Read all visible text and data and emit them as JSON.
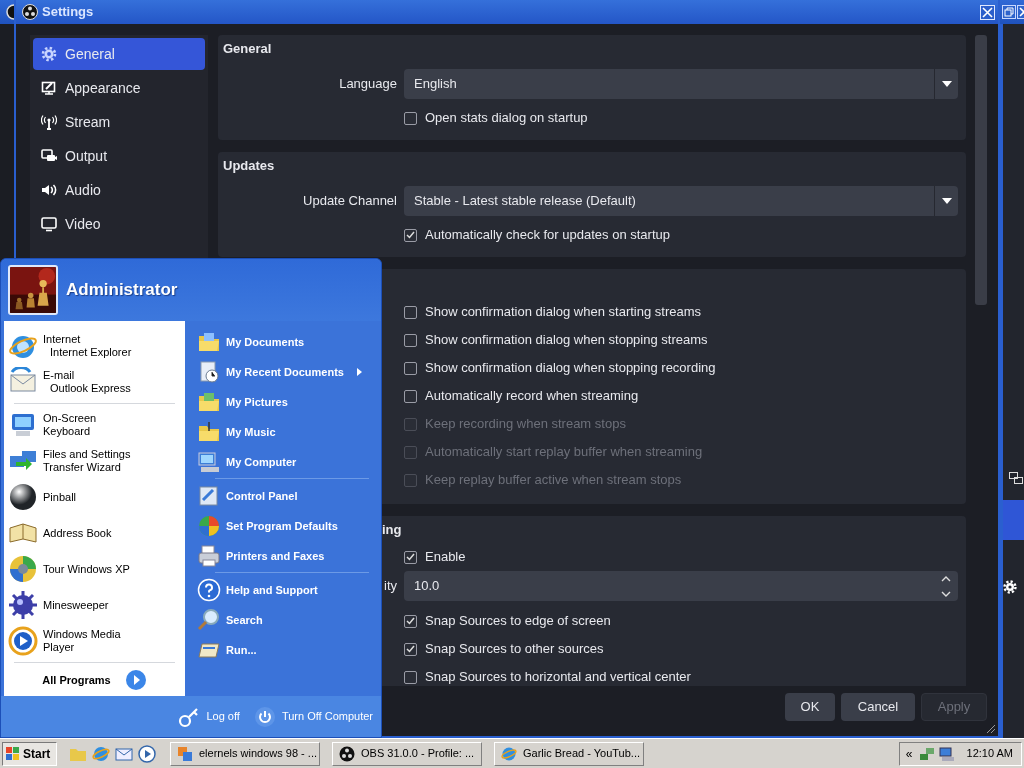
{
  "settings_window": {
    "title": "Settings",
    "sidebar": [
      {
        "label": "General",
        "selected": true
      },
      {
        "label": "Appearance",
        "selected": false
      },
      {
        "label": "Stream",
        "selected": false
      },
      {
        "label": "Output",
        "selected": false
      },
      {
        "label": "Audio",
        "selected": false
      },
      {
        "label": "Video",
        "selected": false
      }
    ],
    "sections": [
      {
        "title": "General",
        "rows": [
          {
            "kind": "dropdown",
            "label": "Language",
            "value": "English"
          },
          {
            "kind": "checkbox",
            "label": "Open stats dialog on startup",
            "checked": false,
            "disabled": false
          }
        ]
      },
      {
        "title": "Updates",
        "rows": [
          {
            "kind": "dropdown",
            "label": "Update Channel",
            "value": "Stable - Latest stable release (Default)"
          },
          {
            "kind": "checkbox",
            "label": "Automatically check for updates on startup",
            "checked": true,
            "disabled": false
          }
        ]
      },
      {
        "rows": [
          {
            "kind": "checkbox",
            "label": "Show confirmation dialog when starting streams",
            "checked": false,
            "disabled": false
          },
          {
            "kind": "checkbox",
            "label": "Show confirmation dialog when stopping streams",
            "checked": false,
            "disabled": false
          },
          {
            "kind": "checkbox",
            "label": "Show confirmation dialog when stopping recording",
            "checked": false,
            "disabled": false
          },
          {
            "kind": "checkbox",
            "label": "Automatically record when streaming",
            "checked": false,
            "disabled": false
          },
          {
            "kind": "checkbox",
            "label": "Keep recording when stream stops",
            "checked": false,
            "disabled": true
          },
          {
            "kind": "checkbox",
            "label": "Automatically start replay buffer when streaming",
            "checked": false,
            "disabled": true
          },
          {
            "kind": "checkbox",
            "label": "Keep replay buffer active when stream stops",
            "checked": false,
            "disabled": true
          }
        ]
      },
      {
        "title": "ing",
        "rows": [
          {
            "kind": "checkbox",
            "label": "Enable",
            "checked": true,
            "disabled": false
          },
          {
            "kind": "spinbox",
            "label": "ity",
            "value": "10.0"
          },
          {
            "kind": "checkbox",
            "label": "Snap Sources to edge of screen",
            "checked": true,
            "disabled": false
          },
          {
            "kind": "checkbox",
            "label": "Snap Sources to other sources",
            "checked": true,
            "disabled": false
          },
          {
            "kind": "checkbox",
            "label": "Snap Sources to horizontal and vertical center",
            "checked": false,
            "disabled": false
          }
        ]
      }
    ],
    "buttons": [
      {
        "label": "OK",
        "disabled": false
      },
      {
        "label": "Cancel",
        "disabled": false
      },
      {
        "label": "Apply",
        "disabled": true
      }
    ]
  },
  "start_menu": {
    "user": "Administrator",
    "pinned": [
      {
        "title": "Internet",
        "subtitle": "Internet Explorer"
      },
      {
        "title": "E-mail",
        "subtitle": "Outlook Express"
      }
    ],
    "recent": [
      {
        "title": "On-Screen Keyboard"
      },
      {
        "title": "Files and Settings Transfer Wizard"
      },
      {
        "title": "Pinball"
      },
      {
        "title": "Address Book"
      },
      {
        "title": "Tour Windows XP"
      },
      {
        "title": "Minesweeper"
      },
      {
        "title": "Windows Media Player"
      }
    ],
    "all_programs": "All Programs",
    "place_groups": [
      {
        "items": [
          {
            "label": "My Documents",
            "submenu": false
          },
          {
            "label": "My Recent Documents",
            "submenu": true
          },
          {
            "label": "My Pictures",
            "submenu": false
          },
          {
            "label": "My Music",
            "submenu": false
          },
          {
            "label": "My Computer",
            "submenu": false
          }
        ]
      },
      {
        "items": [
          {
            "label": "Control Panel",
            "submenu": false
          },
          {
            "label": "Set Program Defaults",
            "submenu": false
          },
          {
            "label": "Printers and Faxes",
            "submenu": false
          }
        ]
      },
      {
        "items": [
          {
            "label": "Help and Support",
            "submenu": false
          },
          {
            "label": "Search",
            "submenu": false
          },
          {
            "label": "Run...",
            "submenu": false
          }
        ]
      }
    ],
    "footer": [
      "Log off",
      "Turn Off Computer"
    ]
  },
  "taskbar": {
    "start": "Start",
    "tasks": [
      "elernels windows 98 - ...",
      "OBS 31.0.0 - Profile: ...",
      "Garlic Bread - YouTub..."
    ],
    "tray_toggle": "«",
    "clock": "12:10 AM"
  }
}
